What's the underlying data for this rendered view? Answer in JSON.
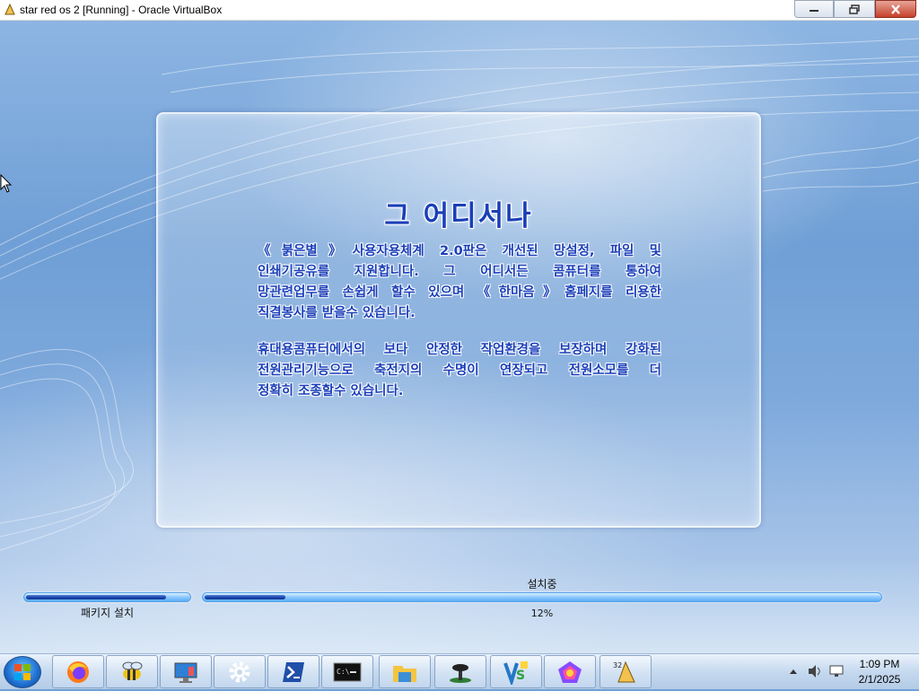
{
  "window": {
    "title": "star red os 2 [Running] - Oracle VirtualBox",
    "buttons": {
      "minimize": "minimize",
      "maximize": "restore",
      "close": "close"
    }
  },
  "installer": {
    "heading": "그 어디서나",
    "paragraph1": [
      "《붉은별》사용자용체계 2.0판은 개선된 망설정, 파일 및",
      "인쇄기공유를 지원합니다. 그 어디서든 콤퓨터를 통하여",
      "망관련업무를 손쉽게 할수 있으며 《한마음》홈페지를 리용한",
      "직결봉사를 받을수 있습니다."
    ],
    "paragraph2": [
      "휴대용콤퓨터에서의 보다 안정한 작업환경을 보장하며 강화된",
      "전원관리기능으로 축전지의 수명이 연장되고 전원소모를 더",
      "정확히 조종할수 있습니다."
    ],
    "package_label": "패키지 설치",
    "package_progress": 0.86,
    "status_label": "설치중",
    "overall_progress": 0.12,
    "overall_percent": "12%"
  },
  "taskbar": {
    "items": [
      "start-icon",
      "firefox-icon",
      "bee-icon",
      "monitor-icon",
      "settings-gear-icon",
      "powershell-icon",
      "terminal-icon",
      "file-explorer-icon",
      "mushroom-icon",
      "vs-icon",
      "pentagon-icon",
      "bell-32-icon"
    ],
    "clock_time": "1:09 PM",
    "clock_date": "2/1/2025"
  },
  "colors": {
    "accent_text": "#1a3fb8",
    "progress_fill": "#1e47b0"
  }
}
